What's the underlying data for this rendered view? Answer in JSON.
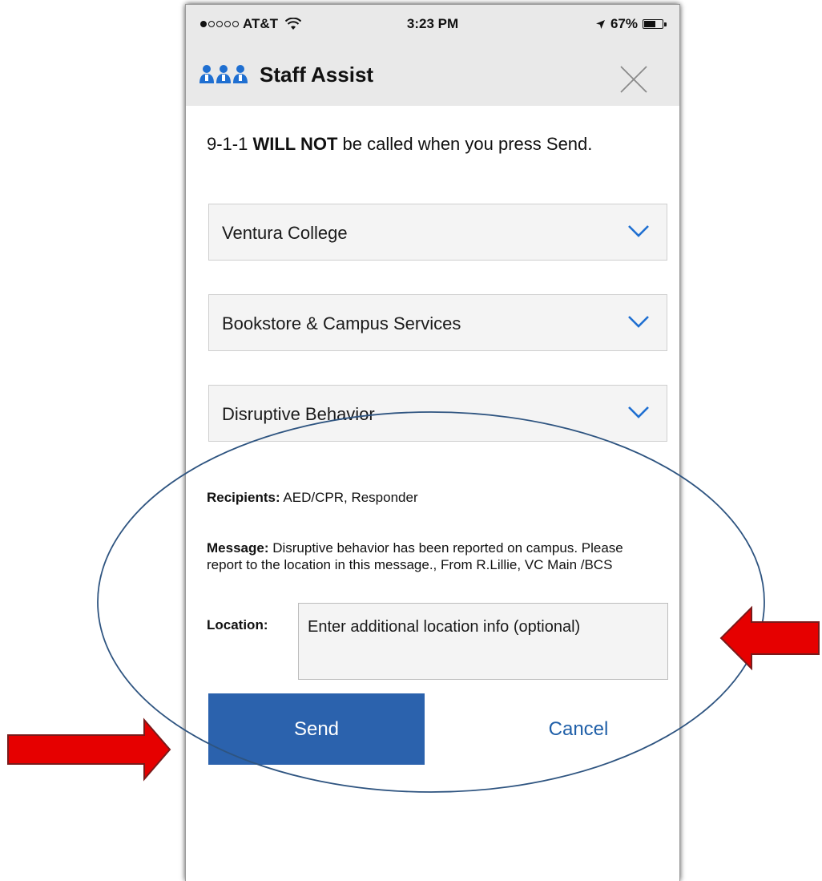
{
  "status_bar": {
    "carrier": "AT&T",
    "signal_bars_filled": 1,
    "signal_bars_total": 5,
    "time": "3:23 PM",
    "battery_percent": "67%",
    "battery_level": 0.67
  },
  "header": {
    "title": "Staff Assist",
    "logo_icon": "staff-group-icon",
    "close_icon": "close-x-icon",
    "accent_color": "#1f6fd1"
  },
  "warning": {
    "prefix": "9-1-1 ",
    "emphasis": "WILL NOT",
    "suffix": " be called when you press Send."
  },
  "dropdowns": [
    {
      "label": "Ventura College"
    },
    {
      "label": "Bookstore & Campus Services"
    },
    {
      "label": "Disruptive Behavior"
    }
  ],
  "recipients": {
    "label": "Recipients:",
    "value": " AED/CPR, Responder"
  },
  "message": {
    "label": "Message:",
    "value": " Disruptive behavior has been reported on campus. Please report to the location in this message., From R.Lillie, VC Main /BCS"
  },
  "location": {
    "label": "Location:",
    "placeholder": "Enter additional location info (optional)"
  },
  "actions": {
    "send_label": "Send",
    "cancel_label": "Cancel",
    "send_color": "#2b62ad",
    "cancel_color": "#1f5fa8"
  },
  "annotations": {
    "ellipse_color": "#2e5480",
    "arrow_color": "#e60000"
  }
}
